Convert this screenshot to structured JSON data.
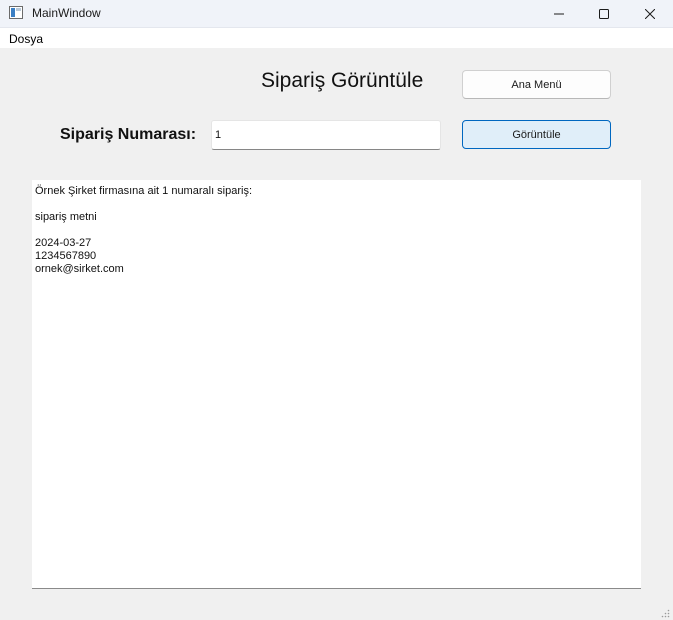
{
  "window": {
    "title": "MainWindow",
    "icon": "app-window-icon",
    "controls": [
      "minimize-icon",
      "maximize-icon",
      "close-icon"
    ]
  },
  "menu": {
    "items": [
      {
        "label": "Dosya"
      }
    ]
  },
  "page": {
    "title": "Sipariş Görüntüle",
    "main_menu_button": "Ana Menü",
    "view_button": "Görüntüle",
    "order_label": "Sipariş Numarası:",
    "order_value": "1"
  },
  "output": {
    "lines": [
      "Örnek Şirket firmasına ait 1 numaralı sipariş:",
      "",
      "sipariş metni",
      "",
      "2024-03-27",
      "1234567890",
      "ornek@sirket.com"
    ]
  },
  "colors": {
    "accent": "#0067c0",
    "accent_bg": "#e0eef9",
    "window_bg": "#f0f0f0"
  }
}
